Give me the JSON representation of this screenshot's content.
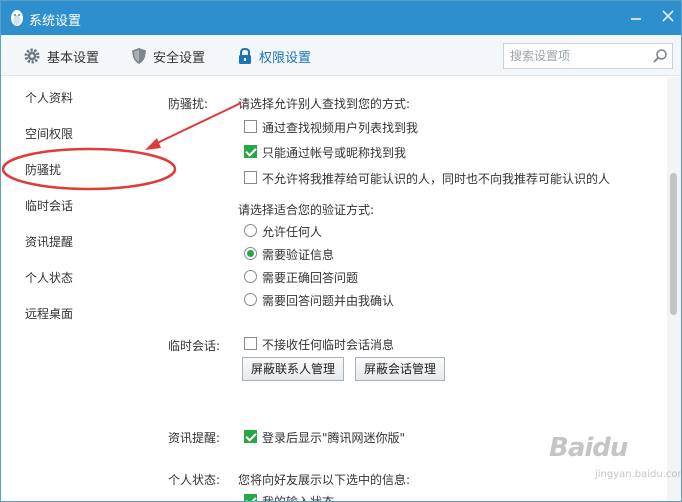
{
  "window": {
    "title": "系统设置"
  },
  "toolbar": {
    "tabs": [
      {
        "label": "基本设置",
        "icon": "gear-icon"
      },
      {
        "label": "安全设置",
        "icon": "shield-icon"
      },
      {
        "label": "权限设置",
        "icon": "lock-icon",
        "active": true
      }
    ],
    "search_placeholder": "搜索设置项"
  },
  "sidebar": {
    "items": [
      {
        "label": "个人资料"
      },
      {
        "label": "空间权限"
      },
      {
        "label": "防骚扰",
        "selected": true
      },
      {
        "label": "临时会话"
      },
      {
        "label": "资讯提醒"
      },
      {
        "label": "个人状态"
      },
      {
        "label": "远程桌面"
      }
    ]
  },
  "harassment": {
    "label": "防骚扰:",
    "find_prompt": "请选择允许别人查找到您的方式:",
    "find_options": [
      {
        "label": "通过查找视频用户列表找到我",
        "checked": false
      },
      {
        "label": "只能通过帐号或昵称找到我",
        "checked": true
      },
      {
        "label": "不允许将我推荐给可能认识的人，同时也不向我推荐可能认识的人",
        "checked": false
      }
    ],
    "verify_prompt": "请选择适合您的验证方式:",
    "verify_options": [
      {
        "label": "允许任何人",
        "selected": false
      },
      {
        "label": "需要验证信息",
        "selected": true
      },
      {
        "label": "需要正确回答问题",
        "selected": false
      },
      {
        "label": "需要回答问题并由我确认",
        "selected": false
      }
    ]
  },
  "temp_session": {
    "label": "临时会话:",
    "option": {
      "label": "不接收任何临时会话消息",
      "checked": false
    },
    "buttons": [
      "屏蔽联系人管理",
      "屏蔽会话管理"
    ]
  },
  "news_reminder": {
    "label": "资讯提醒:",
    "option": {
      "label": "登录后显示\"腾讯网迷你版\"",
      "checked": true
    }
  },
  "personal_status": {
    "label": "个人状态:",
    "prompt": "您将向好友展示以下选中的信息:",
    "option": {
      "label": "我的输入状态",
      "checked": true
    }
  },
  "watermark": {
    "logo": "Baidu",
    "sub": "jingyan.baidu.com"
  },
  "colors": {
    "titlebar": "#2e8fcf",
    "accent": "#1b73b8",
    "check": "#2aa745",
    "annotation": "#e03a3a"
  }
}
